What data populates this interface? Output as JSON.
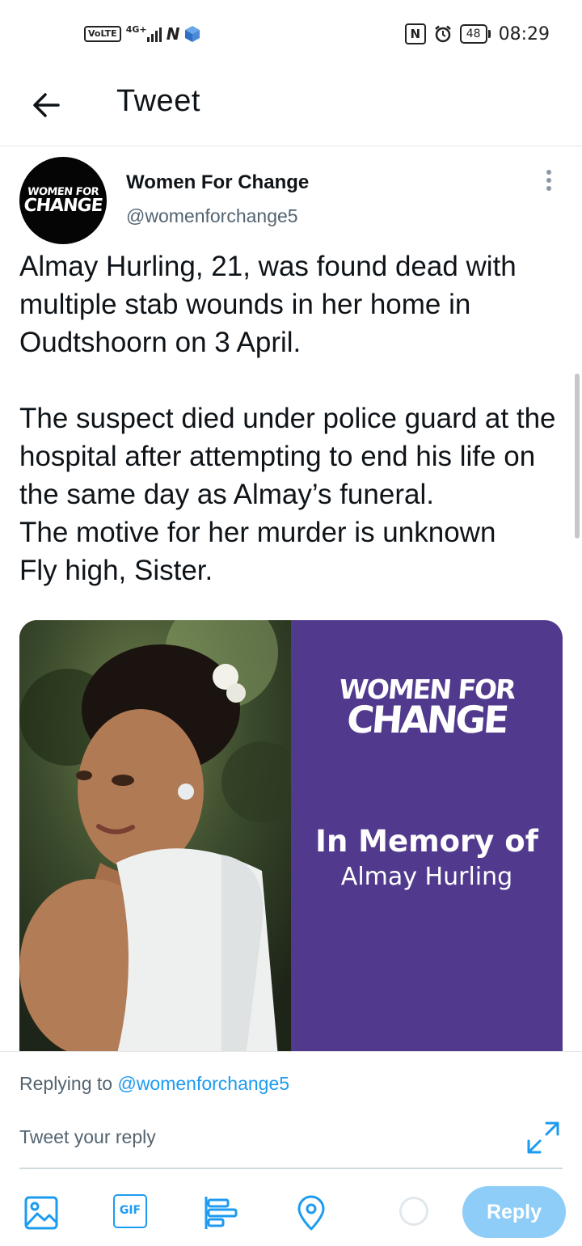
{
  "status_bar": {
    "volte": "VoLTE",
    "network": "4G+",
    "time": "08:29",
    "battery": "48"
  },
  "header": {
    "title": "Tweet"
  },
  "tweet": {
    "author_name": "Women For Change",
    "author_handle": "@womenforchange5",
    "text_paragraph_1": "Almay Hurling, 21, was found dead with multiple stab wounds in her home in Oudtshoorn on 3 April.",
    "text_paragraph_2": "The suspect died under police guard at the hospital after attempting to end his life on the same day as Almay’s funeral.",
    "text_line_3": "The motive for her murder is unknown",
    "text_line_4": "Fly high, Sister.",
    "avatar_logo": {
      "line1": "WOMEN FOR",
      "line2": "CHANGE"
    },
    "media": {
      "logo_line1": "WOMEN FOR",
      "logo_line2": "CHANGE",
      "memorial_line1": "In Memory of",
      "memorial_line2": "Almay Hurling"
    }
  },
  "reply": {
    "replying_prefix": "Replying to",
    "replying_handle": "@womenforchange5",
    "placeholder": "Tweet your reply",
    "gif_label": "GIF",
    "reply_button": "Reply"
  },
  "colors": {
    "accent": "#1d9bf0",
    "reply_button_disabled": "#8ecdf7",
    "memorial_purple": "#513a8d"
  },
  "icons": [
    "back-arrow-icon",
    "more-options-icon",
    "expand-icon",
    "image-icon",
    "gif-icon",
    "poll-icon",
    "location-icon",
    "char-counter-icon"
  ]
}
